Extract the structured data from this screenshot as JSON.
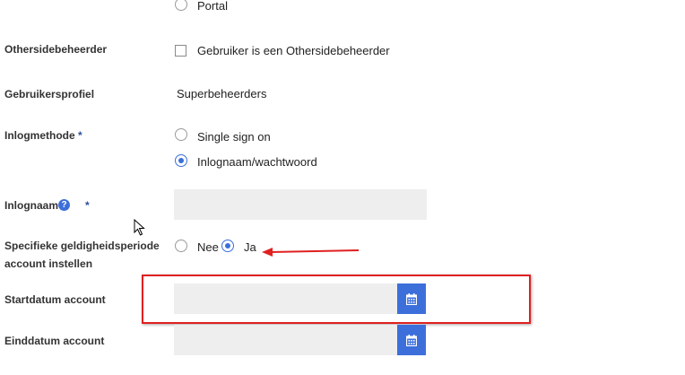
{
  "options": {
    "portal": "Portal"
  },
  "othersidebeheerder": {
    "label": "Othersidebeheerder",
    "checkbox_label": "Gebruiker is een Othersidebeheerder"
  },
  "gebruikersprofiel": {
    "label": "Gebruikersprofiel",
    "value": "Superbeheerders"
  },
  "inlogmethode": {
    "label": "Inlogmethode",
    "required_marker": "*",
    "options": [
      "Single sign on",
      "Inlognaam/wachtwoord"
    ],
    "selected": "Inlognaam/wachtwoord"
  },
  "inlognaam": {
    "label": "Inlognaam",
    "help_icon": "?",
    "required_marker": "*",
    "value": ""
  },
  "geldigheid": {
    "label_line1": "Specifieke geldigheidsperiode",
    "label_line2": "account instellen",
    "options": [
      "Nee",
      "Ja"
    ],
    "selected": "Ja"
  },
  "startdatum": {
    "label": "Startdatum account",
    "value": ""
  },
  "einddatum": {
    "label": "Einddatum account",
    "value": ""
  },
  "annotation_color": "#e02020",
  "icons": [
    "calendar-icon",
    "help-icon",
    "mouse-cursor-icon"
  ]
}
